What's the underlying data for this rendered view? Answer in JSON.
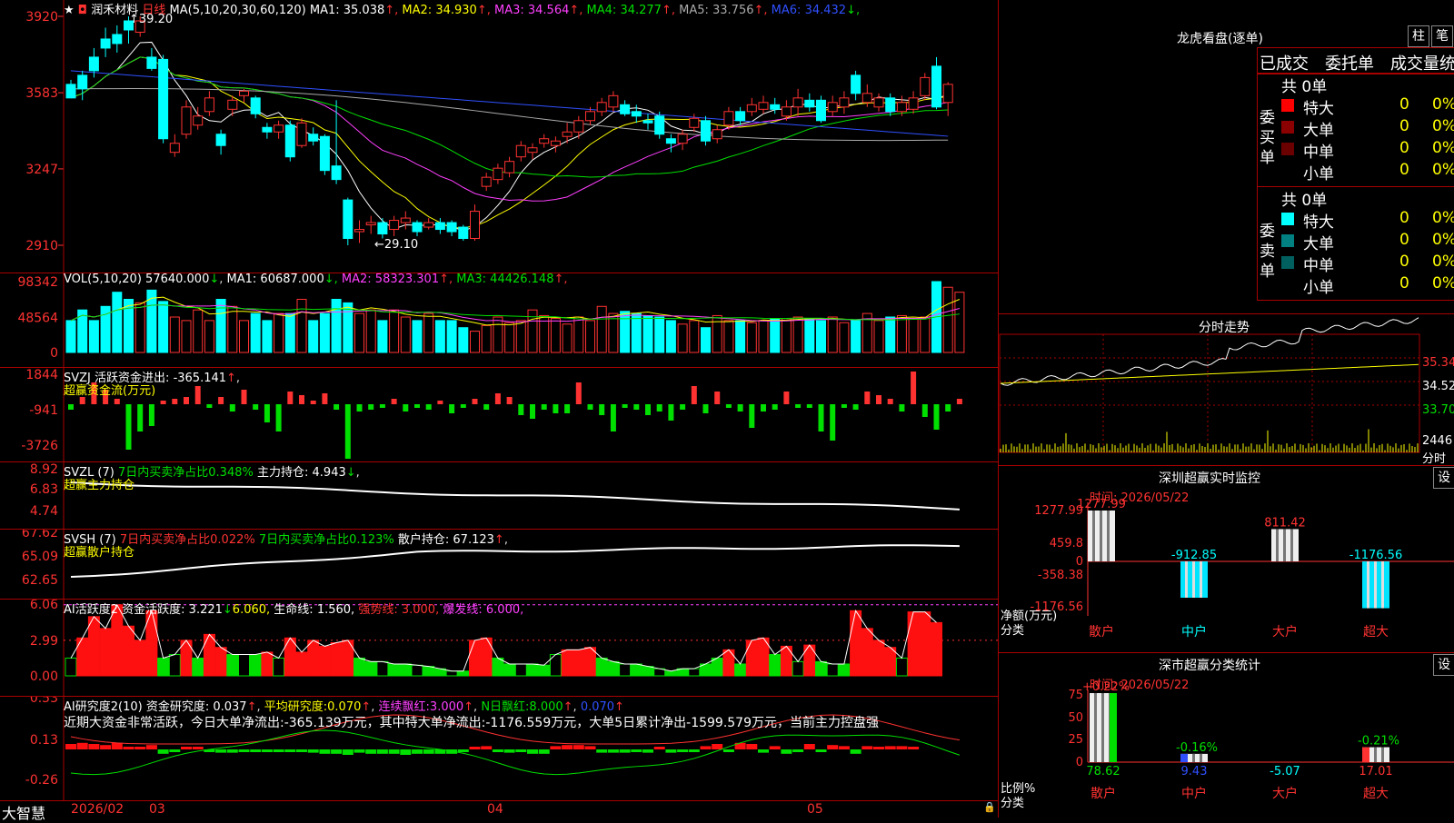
{
  "stock": {
    "name": "润禾材料",
    "period": "日线",
    "star": "★"
  },
  "main": {
    "ma_def": "MA(5,10,20,30,60,120)",
    "ma": [
      {
        "label": "MA1:",
        "value": "35.038",
        "arrow": "↑",
        "color": "#ffffff"
      },
      {
        "label": "MA2:",
        "value": "34.930",
        "arrow": "↑",
        "color": "#ffff00"
      },
      {
        "label": "MA3:",
        "value": "34.564",
        "arrow": "↑",
        "color": "#ff40ff"
      },
      {
        "label": "MA4:",
        "value": "34.277",
        "arrow": "↑",
        "color": "#00e000"
      },
      {
        "label": "MA5:",
        "value": "33.756",
        "arrow": "↑",
        "color": "#aaaaaa"
      },
      {
        "label": "MA6:",
        "value": "34.432",
        "arrow": "↓",
        "color": "#3050ff"
      }
    ],
    "yticks": [
      "3920",
      "3583",
      "3247",
      "2910"
    ],
    "high_label": "39.20",
    "low_label": "29.10"
  },
  "candles": [
    [
      36.2,
      35.6,
      35.8,
      36.4
    ],
    [
      36.6,
      36.0,
      35.5,
      36.8
    ],
    [
      37.4,
      36.8,
      36.5,
      37.8
    ],
    [
      38.2,
      37.8,
      37.4,
      38.7
    ],
    [
      38.4,
      38.0,
      37.6,
      38.8
    ],
    [
      39.0,
      38.6,
      38.0,
      39.2
    ],
    [
      38.5,
      39.0,
      38.3,
      39.2
    ],
    [
      37.4,
      36.9,
      36.8,
      37.8
    ],
    [
      37.3,
      33.8,
      33.6,
      37.5
    ],
    [
      33.2,
      33.6,
      33.0,
      34.0
    ],
    [
      34.0,
      35.2,
      33.8,
      35.5
    ],
    [
      34.4,
      34.8,
      34.2,
      35.2
    ],
    [
      35.0,
      35.6,
      34.8,
      35.9
    ],
    [
      34.0,
      33.5,
      33.1,
      34.2
    ],
    [
      35.1,
      35.5,
      34.8,
      35.7
    ],
    [
      35.7,
      35.9,
      35.4,
      36.0
    ],
    [
      35.6,
      34.9,
      34.7,
      35.7
    ],
    [
      34.3,
      34.1,
      33.8,
      34.5
    ],
    [
      34.1,
      34.4,
      33.8,
      34.6
    ],
    [
      34.4,
      33.0,
      32.8,
      34.6
    ],
    [
      33.5,
      34.5,
      33.4,
      34.7
    ],
    [
      34.0,
      33.7,
      33.5,
      34.3
    ],
    [
      33.9,
      32.4,
      32.2,
      34.0
    ],
    [
      32.6,
      32.0,
      31.8,
      35.5
    ],
    [
      31.1,
      29.4,
      29.1,
      31.2
    ],
    [
      29.7,
      29.8,
      29.2,
      30.2
    ],
    [
      30.0,
      30.1,
      29.6,
      30.4
    ],
    [
      30.1,
      29.6,
      29.4,
      30.3
    ],
    [
      29.8,
      30.2,
      29.5,
      30.4
    ],
    [
      30.1,
      30.3,
      29.8,
      30.6
    ],
    [
      30.1,
      29.7,
      29.5,
      30.2
    ],
    [
      29.9,
      30.1,
      29.8,
      30.3
    ],
    [
      30.1,
      29.8,
      29.6,
      30.3
    ],
    [
      30.1,
      29.7,
      29.5,
      30.2
    ],
    [
      29.9,
      29.4,
      29.3,
      30.0
    ],
    [
      29.4,
      30.6,
      29.3,
      30.9
    ],
    [
      31.7,
      32.1,
      31.5,
      32.3
    ],
    [
      32.0,
      32.5,
      31.8,
      32.7
    ],
    [
      32.3,
      32.8,
      32.1,
      33.0
    ],
    [
      33.0,
      33.5,
      32.8,
      33.7
    ],
    [
      33.2,
      33.4,
      32.9,
      33.6
    ],
    [
      33.6,
      33.8,
      33.4,
      34.0
    ],
    [
      33.5,
      33.7,
      33.2,
      33.9
    ],
    [
      33.9,
      34.1,
      33.6,
      34.5
    ],
    [
      34.1,
      34.6,
      33.8,
      34.8
    ],
    [
      34.6,
      35.0,
      34.4,
      35.2
    ],
    [
      35.0,
      35.4,
      34.8,
      35.6
    ],
    [
      35.2,
      35.7,
      35.0,
      35.9
    ],
    [
      35.3,
      34.9,
      34.8,
      35.5
    ],
    [
      35.0,
      34.8,
      34.5,
      35.3
    ],
    [
      34.6,
      34.5,
      34.2,
      34.9
    ],
    [
      34.8,
      34.0,
      33.8,
      35.0
    ],
    [
      33.8,
      33.6,
      33.2,
      34.0
    ],
    [
      33.6,
      34.0,
      33.3,
      34.2
    ],
    [
      34.3,
      34.7,
      34.1,
      34.9
    ],
    [
      34.6,
      33.7,
      33.5,
      34.8
    ],
    [
      33.8,
      34.2,
      33.6,
      34.4
    ],
    [
      34.4,
      35.0,
      34.2,
      35.2
    ],
    [
      35.0,
      34.6,
      34.4,
      35.2
    ],
    [
      35.0,
      35.3,
      34.8,
      35.6
    ],
    [
      35.1,
      35.4,
      34.9,
      35.7
    ],
    [
      35.3,
      35.1,
      34.9,
      35.6
    ],
    [
      34.8,
      35.2,
      34.6,
      35.5
    ],
    [
      35.2,
      35.6,
      34.8,
      36.0
    ],
    [
      35.5,
      35.2,
      35.0,
      35.8
    ],
    [
      35.5,
      34.6,
      34.5,
      35.7
    ],
    [
      35.0,
      35.4,
      34.8,
      35.7
    ],
    [
      35.2,
      35.6,
      34.9,
      35.9
    ],
    [
      36.6,
      35.8,
      35.5,
      36.8
    ],
    [
      35.4,
      35.8,
      35.2,
      36.2
    ],
    [
      35.2,
      35.6,
      35.0,
      35.8
    ],
    [
      35.6,
      35.0,
      34.8,
      35.8
    ],
    [
      35.0,
      35.4,
      34.8,
      35.7
    ],
    [
      35.1,
      35.6,
      34.9,
      35.9
    ],
    [
      35.7,
      36.5,
      35.5,
      36.7
    ],
    [
      37.0,
      35.2,
      35.1,
      37.4
    ],
    [
      35.4,
      36.2,
      34.8,
      36.3
    ]
  ],
  "vol": {
    "def": "VOL(5,10,20)",
    "value": "57640.000",
    "value_arrow": "↓",
    "ma": [
      {
        "label": "MA1:",
        "value": "60687.000",
        "arrow": "↓",
        "color": "#ffffff"
      },
      {
        "label": "MA2:",
        "value": "58323.301",
        "arrow": "↑",
        "color": "#ff40ff"
      },
      {
        "label": "MA3:",
        "value": "44426.148",
        "arrow": "↑",
        "color": "#00e000"
      }
    ],
    "yticks": [
      "98342",
      "48564",
      "0"
    ],
    "values": [
      45,
      60,
      45,
      65,
      85,
      75,
      70,
      88,
      72,
      50,
      45,
      60,
      45,
      75,
      65,
      45,
      55,
      45,
      55,
      55,
      75,
      45,
      55,
      75,
      70,
      55,
      60,
      45,
      60,
      50,
      45,
      55,
      45,
      45,
      35,
      30,
      38,
      50,
      42,
      45,
      60,
      52,
      48,
      40,
      50,
      45,
      65,
      55,
      58,
      55,
      52,
      50,
      45,
      40,
      45,
      35,
      52,
      45,
      45,
      42,
      45,
      48,
      48,
      50,
      48,
      45,
      50,
      42,
      45,
      55,
      45,
      50,
      52,
      48,
      50,
      100,
      92,
      85
    ]
  },
  "svzj": {
    "title": "SVZJ",
    "label": "活跃资金进出:",
    "value": "-365.141",
    "arrow": "↑",
    "subtitle": "超赢资金流(万元)",
    "yticks": [
      "1844",
      "-941",
      "-3726"
    ],
    "values": [
      -300,
      400,
      1200,
      800,
      300,
      -2500,
      -1500,
      -1200,
      200,
      300,
      400,
      1000,
      -200,
      400,
      -400,
      800,
      -300,
      -1000,
      -1500,
      700,
      500,
      200,
      600,
      -300,
      -3000,
      -400,
      -300,
      -200,
      300,
      -400,
      -200,
      -300,
      200,
      -500,
      -200,
      300,
      -300,
      600,
      400,
      -600,
      -800,
      -300,
      -500,
      -500,
      1200,
      -300,
      -600,
      -1500,
      -200,
      -300,
      -600,
      -400,
      -900,
      -300,
      1000,
      -500,
      700,
      -200,
      -400,
      -1300,
      -400,
      -300,
      700,
      -200,
      -200,
      -1500,
      -2000,
      -200,
      -300,
      700,
      500,
      300,
      -400,
      1800,
      -700,
      -1400,
      -400,
      300
    ]
  },
  "svzl": {
    "title": "SVZL (7)",
    "label": "7日内买卖净占比",
    "value": "0.348%",
    "label2": "主力持仓:",
    "value2": "4.943",
    "arrow": "↓",
    "subtitle": "超赢主力持仓",
    "yticks": [
      "8.92",
      "6.83",
      "4.74"
    ]
  },
  "svsh": {
    "title": "SVSH (7)",
    "label": "7日内买卖净占比",
    "value": "0.022%",
    "label2": "7日内买卖净占比",
    "value2": "0.123%",
    "label3": "散户持仓:",
    "value3": "67.123",
    "arrow": "↑",
    "subtitle": "超赢散户持仓",
    "yticks": [
      "67.62",
      "65.09",
      "62.65"
    ]
  },
  "ai1": {
    "title": "AI活跃度2",
    "label": "资金活跃度:",
    "value": "3.221",
    "arrow": "↓",
    "value_b": "6.060,",
    "life": "生命线:",
    "life_v": "1.560,",
    "strong": "强势线:",
    "strong_v": "3.000,",
    "burst": "爆发线:",
    "burst_v": "6.000,",
    "yticks": [
      "6.06",
      "2.99",
      "0.00"
    ],
    "values": [
      1.5,
      3.2,
      5.0,
      4.0,
      6.0,
      4.2,
      3.0,
      5.5,
      1.5,
      1.8,
      3.0,
      1.5,
      3.5,
      2.4,
      1.8,
      1.8,
      1.8,
      2.0,
      1.5,
      3.2,
      2.0,
      3.0,
      2.5,
      2.8,
      3.0,
      1.5,
      1.2,
      1.2,
      1.0,
      1.0,
      0.9,
      0.8,
      0.6,
      0.4,
      0.4,
      3.0,
      3.2,
      1.5,
      1.0,
      1.0,
      1.0,
      0.9,
      1.8,
      2.2,
      2.2,
      2.4,
      1.5,
      1.2,
      1.0,
      1.0,
      0.8,
      0.6,
      0.4,
      0.6,
      0.6,
      1.0,
      1.5,
      2.2,
      1.0,
      3.0,
      3.2,
      1.8,
      2.5,
      1.2,
      2.6,
      1.2,
      1.0,
      1.0,
      5.5,
      4.0,
      3.0,
      2.4,
      1.5,
      5.4,
      5.4,
      4.5
    ]
  },
  "ai2": {
    "title": "AI研究度2(10)",
    "label": "资金研究度:",
    "value": "0.037",
    "arrow": "↑",
    "avg": "平均研究度:",
    "avg_v": "0.070",
    "avg_arrow": "↑",
    "red": "连续飘红:",
    "red_v": "3.000",
    "red_arrow": "↑",
    "nred": "N日飘红:",
    "nred_v": "8.000",
    "nred_arrow": "↑",
    "last": "0.070",
    "last_arrow": "↑",
    "note": "近期大资金非常活跃，今日大单净流出:-365.139万元，其中特大单净流出:-1176.559万元，大单5日累计净出-1599.579万元，当前主力控盘强",
    "yticks": [
      "0.53",
      "0.13",
      "-0.26"
    ],
    "values": [
      0.05,
      0.06,
      0.05,
      0.04,
      0.06,
      0.02,
      0.02,
      0.04,
      -0.04,
      -0.02,
      0.01,
      0.01,
      -0.02,
      -0.03,
      -0.03,
      -0.02,
      -0.02,
      -0.01,
      0,
      -0.02,
      -0.02,
      -0.03,
      -0.04,
      -0.04,
      -0.05,
      -0.03,
      -0.04,
      -0.04,
      -0.04,
      -0.05,
      -0.04,
      -0.04,
      -0.04,
      -0.04,
      -0.02,
      0.02,
      0.03,
      -0.02,
      -0.03,
      -0.02,
      -0.04,
      -0.04,
      0.03,
      0.04,
      0.04,
      0.03,
      -0.03,
      -0.03,
      -0.03,
      -0.02,
      -0.03,
      0.02,
      -0.03,
      -0.02,
      -0.01,
      0.03,
      0.05,
      0,
      0.06,
      0.05,
      -0.03,
      0.03,
      -0.04,
      0,
      0.05,
      -0.02,
      0.04,
      0.03,
      -0.04,
      0.03,
      0.02,
      0.03,
      0.03,
      0.02
    ]
  },
  "time_axis": {
    "brand": "大智慧",
    "labels": [
      "2026/02",
      "03",
      "04",
      "05"
    ]
  },
  "longhu": {
    "title": "龙虎看盘(逐单)",
    "btn1": "柱",
    "btn2": "笔",
    "tabs": [
      "已成交",
      "委托单",
      "成交量统计"
    ],
    "buy_side": "委买单",
    "sell_side": "委卖单",
    "buy_total": "共 0单",
    "sell_total": "共 0单",
    "buy_rows": [
      {
        "name": "特大",
        "count": "0",
        "pct": "0%",
        "color": "#ff0000"
      },
      {
        "name": "大单",
        "count": "0",
        "pct": "0%",
        "color": "#8b0000"
      },
      {
        "name": "中单",
        "count": "0",
        "pct": "0%",
        "color": "#6b0000"
      },
      {
        "name": "小单",
        "count": "0",
        "pct": "0%",
        "color": ""
      }
    ],
    "sell_rows": [
      {
        "name": "特大",
        "count": "0",
        "pct": "0%",
        "color": "#00ffff"
      },
      {
        "name": "大单",
        "count": "0",
        "pct": "0%",
        "color": "#008080"
      },
      {
        "name": "中单",
        "count": "0",
        "pct": "0%",
        "color": "#006060"
      },
      {
        "name": "小单",
        "count": "0",
        "pct": "0%",
        "color": ""
      }
    ]
  },
  "fenshi": {
    "title": "分时走势",
    "prices": [
      "35.34",
      "34.52",
      "33.70"
    ],
    "vol": "2446",
    "unit": "分时"
  },
  "sz_monitor": {
    "title": "深圳超赢实时监控",
    "btn": "设",
    "time": "时间: 2026/05/22",
    "yticks": [
      "1277.99",
      "459.8",
      "0",
      "-358.38",
      "-1176.56"
    ],
    "ylabel": "净额(万元)",
    "xlabel": "分类",
    "bars": [
      {
        "name": "散户",
        "value": 1277.99,
        "label": "1277.99"
      },
      {
        "name": "中户",
        "value": -912.85,
        "label": "-912.85"
      },
      {
        "name": "大户",
        "value": 811.42,
        "label": "811.42"
      },
      {
        "name": "超大",
        "value": -1176.56,
        "label": "-1176.56"
      }
    ]
  },
  "sz_class": {
    "title": "深市超赢分类统计",
    "btn": "设",
    "time": "时间: 2026/05/22",
    "yticks": [
      "75",
      "50",
      "25",
      "0"
    ],
    "ylabel": "比例%",
    "xlabel": "分类",
    "bars": [
      {
        "name": "散户",
        "value": 78.62,
        "label": "78.62",
        "top": "+0.22%"
      },
      {
        "name": "中户",
        "value": 9.43,
        "label": "9.43",
        "top": "-0.16%"
      },
      {
        "name": "大户",
        "value": -5.07,
        "label": "-5.07",
        "top": ""
      },
      {
        "name": "超大",
        "value": 17.01,
        "label": "17.01",
        "top": "-0.21%"
      }
    ]
  }
}
